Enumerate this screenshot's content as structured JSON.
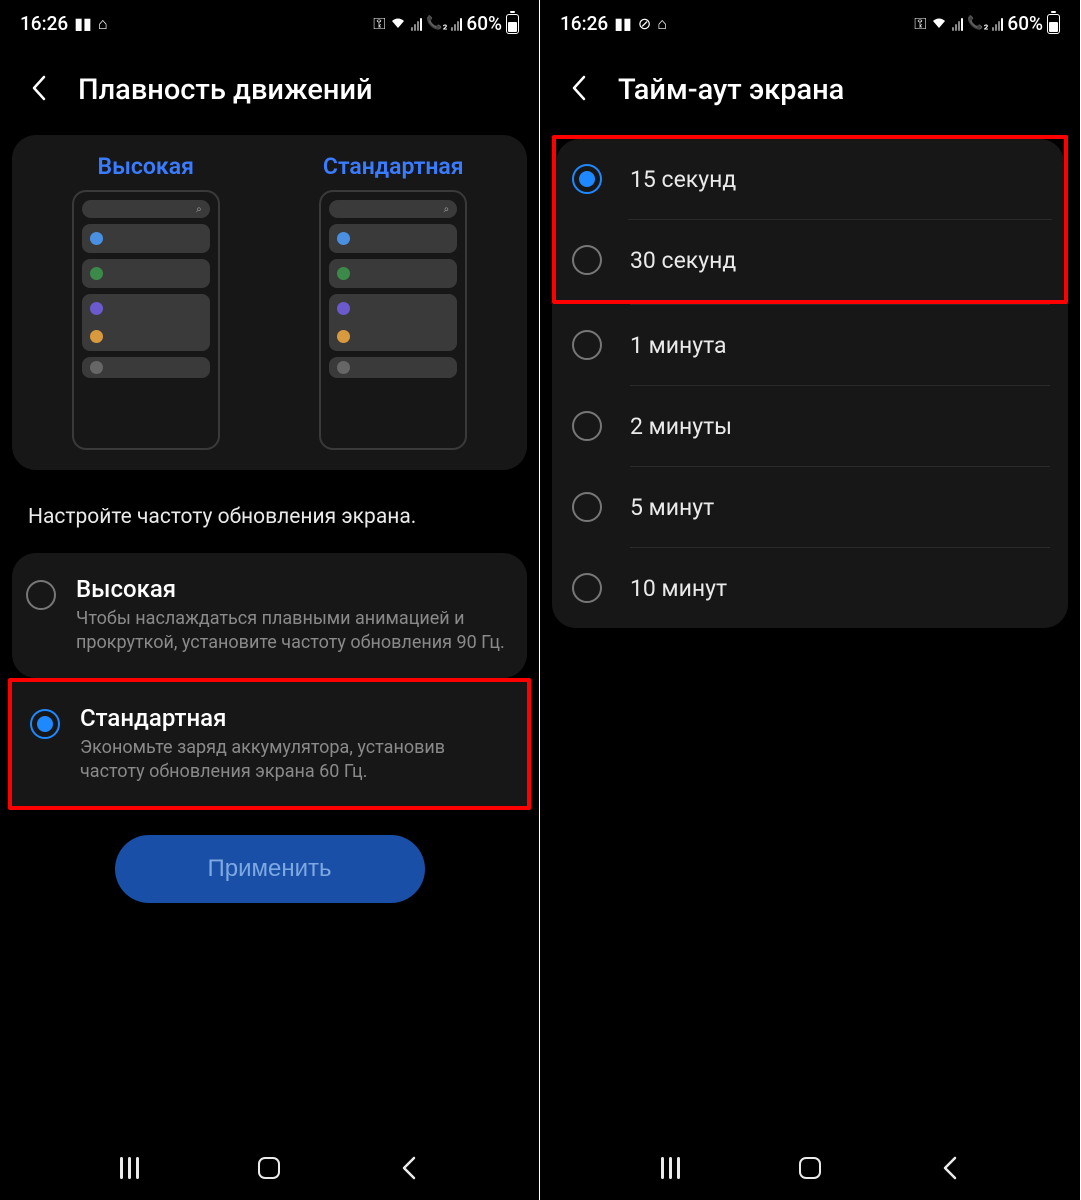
{
  "status": {
    "time": "16:26",
    "battery_text": "60%"
  },
  "left": {
    "title": "Плавность движений",
    "preview": {
      "high_label": "Высокая",
      "standard_label": "Стандартная"
    },
    "description": "Настройте частоту обновления экрана.",
    "options": [
      {
        "title": "Высокая",
        "desc": "Чтобы наслаждаться плавными анимацией и прокруткой, установите частоту обновления 90 Гц.",
        "selected": false
      },
      {
        "title": "Стандартная",
        "desc": "Экономьте заряд аккумулятора, установив частоту обновления экрана 60 Гц.",
        "selected": true
      }
    ],
    "apply_label": "Применить",
    "highlighted_option_index": 1
  },
  "right": {
    "title": "Тайм-аут экрана",
    "options": [
      {
        "label": "15 секунд",
        "selected": true
      },
      {
        "label": "30 секунд",
        "selected": false
      },
      {
        "label": "1 минута",
        "selected": false
      },
      {
        "label": "2 минуты",
        "selected": false
      },
      {
        "label": "5 минут",
        "selected": false
      },
      {
        "label": "10 минут",
        "selected": false
      }
    ],
    "highlighted_option_indices": [
      0,
      1
    ]
  }
}
